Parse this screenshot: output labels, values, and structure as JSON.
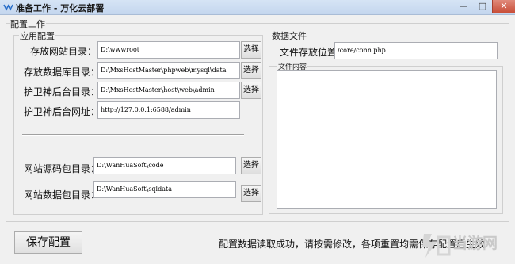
{
  "window": {
    "title": "准备工作 - 万化云部署",
    "min_glyph": "—",
    "max_glyph": "□",
    "close_glyph": "✕"
  },
  "config_group": {
    "legend": "配置工作"
  },
  "app_config": {
    "legend": "应用配置",
    "rows": [
      {
        "label": "存放网站目录：",
        "value": "D:\\wwwroot",
        "button": "选择"
      },
      {
        "label": "存放数据库目录：",
        "value": "D:\\MxsHostMaster\\phpweb\\mysql\\data",
        "button": "选择"
      },
      {
        "label": "护卫神后台目录：",
        "value": "D:\\MxsHostMaster\\host\\web\\admin",
        "button": "选择"
      },
      {
        "label": "护卫神后台网址：",
        "value": "http://127.0.0.1:6588/admin"
      }
    ],
    "bottom_rows": [
      {
        "label": "网站源码包目录：",
        "value": "D:\\WanHuaSoft\\code",
        "button": "选择"
      },
      {
        "label": "网站数据包目录：",
        "value": "D:\\WanHuaSoft\\sqldata",
        "button": "选择"
      }
    ]
  },
  "data_file": {
    "legend": "数据文件",
    "location_label": "文件存放位置：",
    "location_value": "/core/conn.php",
    "content_legend": "文件内容",
    "content": ""
  },
  "footer": {
    "save_label": "保存配置",
    "status_text": "配置数据读取成功，请按需修改，各项重置均需保存配置后生效"
  },
  "watermark": {
    "text": "当游网"
  },
  "colors": {
    "title_bar": "#c4d6ee",
    "close_button": "#c74a34",
    "background": "#f0f0f0"
  }
}
